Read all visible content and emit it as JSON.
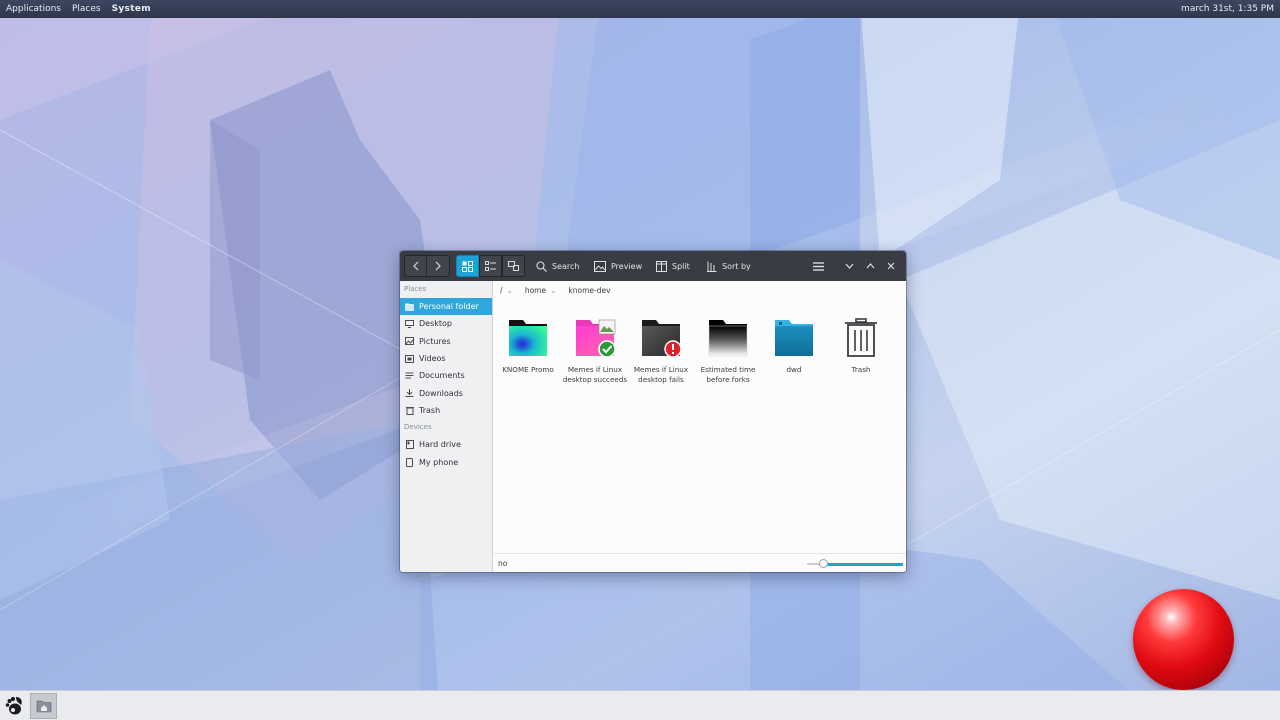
{
  "top_panel": {
    "menus": [
      "Applications",
      "Places",
      "System"
    ],
    "clock": "march 31st, 1:35 PM"
  },
  "window": {
    "toolbar": {
      "back_icon": "chevron-left-icon",
      "forward_icon": "chevron-right-icon",
      "view_modes": [
        "icon-view",
        "list-view",
        "compact-view"
      ],
      "active_view": "icon-view",
      "search_label": "Search",
      "preview_label": "Preview",
      "split_label": "Split",
      "sortby_label": "Sort by"
    },
    "sidebar": {
      "places_heading": "Places",
      "places": [
        {
          "label": "Personal folder",
          "icon": "home-icon",
          "active": true
        },
        {
          "label": "Desktop",
          "icon": "desktop-icon",
          "active": false
        },
        {
          "label": "Pictures",
          "icon": "pictures-icon",
          "active": false
        },
        {
          "label": "Videos",
          "icon": "videos-icon",
          "active": false
        },
        {
          "label": "Documents",
          "icon": "documents-icon",
          "active": false
        },
        {
          "label": "Downloads",
          "icon": "downloads-icon",
          "active": false
        },
        {
          "label": "Trash",
          "icon": "trash-icon",
          "active": false
        }
      ],
      "devices_heading": "Devices",
      "devices": [
        {
          "label": "Hard drive",
          "icon": "hard-drive-icon"
        },
        {
          "label": "My phone",
          "icon": "phone-icon"
        }
      ]
    },
    "breadcrumb": [
      "/",
      "home",
      "knome-dev"
    ],
    "files": [
      {
        "label": "KNOME Promo",
        "icon": "gradient-folder-icon"
      },
      {
        "label": "Memes if Linux desktop succeeds",
        "icon": "pink-folder-success-icon"
      },
      {
        "label": "Memes if Linux desktop fails",
        "icon": "dark-folder-error-icon"
      },
      {
        "label": "Estimated time before forks",
        "icon": "gradient-black-folder-icon"
      },
      {
        "label": "dwd",
        "icon": "blue-folder-icon"
      },
      {
        "label": "Trash",
        "icon": "trash-can-icon"
      }
    ],
    "status_text": "no",
    "zoom_level": 0.17
  },
  "colors": {
    "accent": "#1ea1d6",
    "headerbar": "#393c42",
    "sidebar_bg": "#eff0f1",
    "ball": "#e10a12"
  }
}
